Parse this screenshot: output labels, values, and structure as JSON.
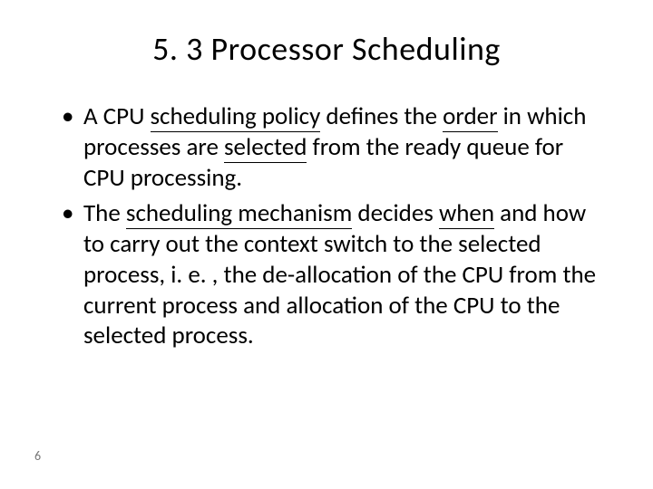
{
  "title": "5. 3 Processor Scheduling",
  "bullet1": {
    "p1": "A CPU ",
    "p2": "scheduling policy",
    "p3": " defines the ",
    "p4": "order",
    "p5": " in which processes are ",
    "p6": "selected",
    "p7": "  from the ready queue for CPU processing."
  },
  "bullet2": {
    "p1": "The ",
    "p2": "scheduling mechanism",
    "p3": " decides ",
    "p4": "when",
    "p5": " and how to carry out the context switch to the selected process, i. e. , the de-allocation of the CPU from the current process and allocation of the CPU to the selected process."
  },
  "page_number": "6"
}
